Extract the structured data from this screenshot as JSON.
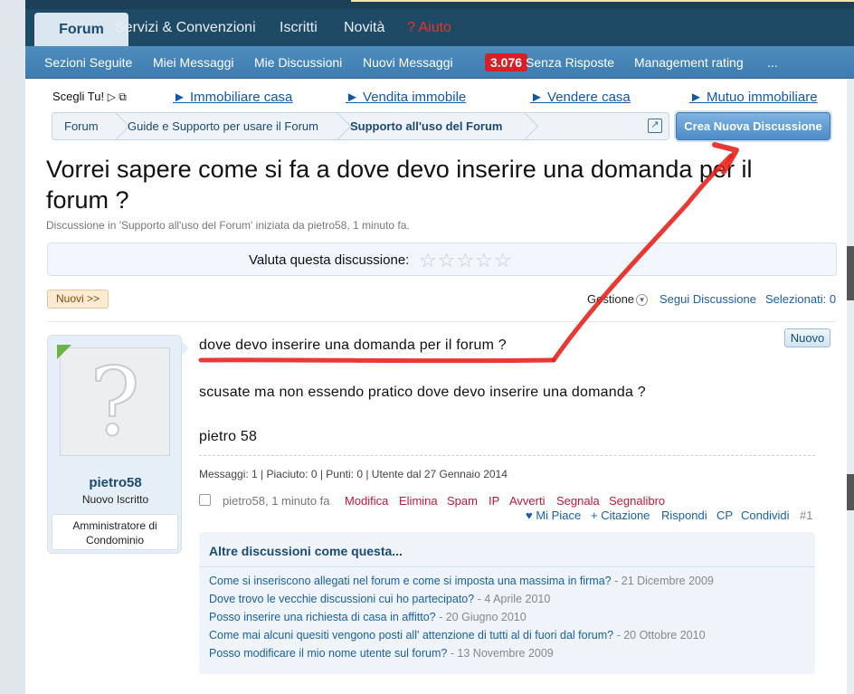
{
  "main_nav": {
    "tabs": [
      "Forum",
      "Servizi & Convenzioni",
      "Iscritti",
      "Novità",
      "? Aiuto"
    ]
  },
  "sub_nav": {
    "items": [
      "Sezioni Seguite",
      "Miei Messaggi",
      "Mie Discussioni",
      "Nuovi Messaggi",
      "Senza Risposte",
      "Management rating",
      "..."
    ],
    "new_count": "3.076"
  },
  "ads": {
    "label": "Scegli Tu!",
    "links": [
      "► Immobiliare casa",
      "► Vendita immobile",
      "► Vendere casa",
      "► Mutuo immobiliare"
    ]
  },
  "breadcrumb": [
    "Forum",
    "Guide e Supporto per usare il Forum",
    "Supporto all'uso del Forum"
  ],
  "new_thread_label": "Crea Nuova Discussione",
  "thread": {
    "title": "Vorrei sapere come si fa a dove devo inserire una domanda per il forum ?",
    "meta": "Discussione in 'Supporto all'uso del Forum' iniziata da pietro58, 1 minuto fa.",
    "rating_label": "Valuta questa discussione:",
    "stars": "☆☆☆☆☆",
    "rating_value": 0
  },
  "toolbar": {
    "new_label": "Nuovi >>",
    "manage": "Gestione",
    "follow": "Segui Discussione",
    "selected": "Selezionati: 0"
  },
  "user": {
    "name": "pietro58",
    "title": "Nuovo Iscritto",
    "banner": "Amministratore di Condominio"
  },
  "post": {
    "new_tag": "Nuovo",
    "lines": [
      "dove devo inserire una domanda per il forum ?",
      "scusate ma non essendo pratico dove devo inserire una domanda ?",
      "pietro 58"
    ],
    "stats": "Messaggi: 1 | Piaciuto: 0 | Punti: 0 | Utente dal 27 Gennaio 2014",
    "author_time": "pietro58, 1 minuto fa",
    "actions_red": [
      "Modifica",
      "Elimina",
      "Spam",
      "IP",
      "Avverti",
      "Segnala",
      "Segnalibro"
    ],
    "actions_blue": [
      "♥ Mi Piace",
      "+ Citazione",
      "Rispondi",
      "CP",
      "Condividi"
    ],
    "number": "#1"
  },
  "similar": {
    "title": "Altre discussioni come questa...",
    "items": [
      {
        "t": "Come si inseriscono allegati nel forum e come si imposta una massima in firma?",
        "d": "- 21 Dicembre 2009"
      },
      {
        "t": "Dove trovo le vecchie discussioni cui ho partecipato?",
        "d": "- 4 Aprile 2010"
      },
      {
        "t": "Posso inserire una richiesta di casa in affitto?",
        "d": "- 20 Giugno 2010"
      },
      {
        "t": "Come mai alcuni quesiti vengono posti all' attenzione di tutti al di fuori dal forum?",
        "d": "- 20 Ottobre 2010"
      },
      {
        "t": "Posso modificare il mio nome utente sul forum?",
        "d": "- 13 Novembre 2009"
      }
    ]
  },
  "colors": {
    "nav": "#1f4a66",
    "subnav": "#3e7cb0",
    "badge": "#d91f26",
    "annotation": "#e8221c",
    "link": "#1b5fa6"
  }
}
